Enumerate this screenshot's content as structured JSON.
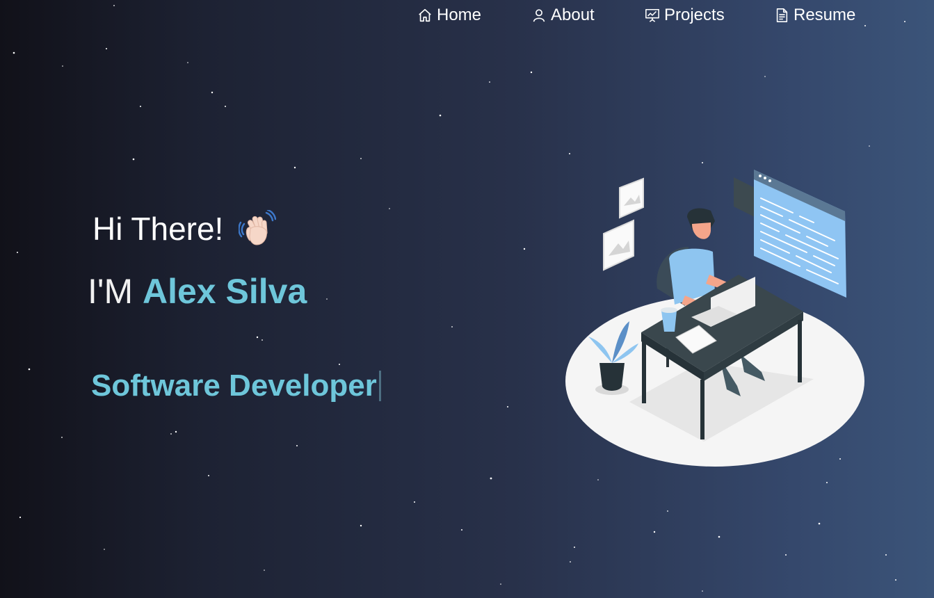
{
  "nav": {
    "items": [
      {
        "label": "Home",
        "icon": "home-icon"
      },
      {
        "label": "About",
        "icon": "user-icon"
      },
      {
        "label": "Projects",
        "icon": "presentation-chart-icon"
      },
      {
        "label": "Resume",
        "icon": "document-icon"
      }
    ]
  },
  "hero": {
    "greeting": "Hi There!",
    "wave_icon": "waving-hand-icon",
    "intro_prefix": "I'M",
    "name": "Alex Silva",
    "role": "Software Developer"
  },
  "illustration": {
    "icon": "developer-at-desk-illustration"
  },
  "colors": {
    "accent": "#6ec6da",
    "background_start": "#111119",
    "background_end": "#3b5479"
  }
}
